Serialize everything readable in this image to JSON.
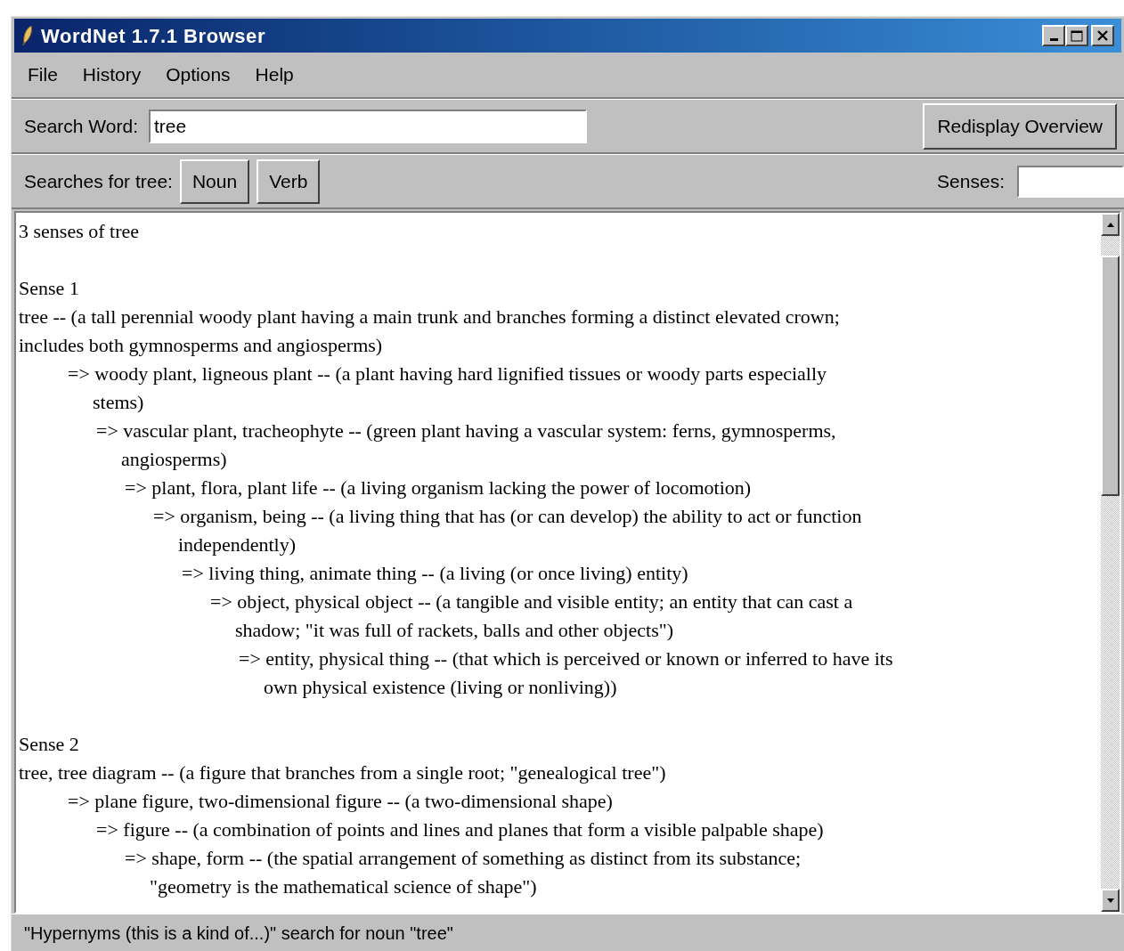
{
  "window": {
    "title": "WordNet 1.7.1 Browser"
  },
  "menu": [
    "File",
    "History",
    "Options",
    "Help"
  ],
  "search": {
    "label": "Search Word:",
    "value": "tree",
    "button": "Redisplay Overview"
  },
  "searches": {
    "label": "Searches for tree:",
    "buttons": [
      "Noun",
      "Verb"
    ],
    "senses_label": "Senses:"
  },
  "content": {
    "heading": "3 senses of tree",
    "senses": [
      {
        "title": "Sense 1",
        "entry": {
          "lines": [
            "tree -- (a tall perennial woody plant having a main trunk and branches forming a distinct elevated crown;",
            "includes both gymnosperms and angiosperms)"
          ],
          "children": [
            {
              "lines": [
                "=> woody plant, ligneous plant -- (a plant having hard lignified tissues or woody parts especially",
                "stems)"
              ],
              "children": [
                {
                  "lines": [
                    "=> vascular plant, tracheophyte -- (green plant having a vascular system: ferns, gymnosperms,",
                    "angiosperms)"
                  ],
                  "children": [
                    {
                      "lines": [
                        "=> plant, flora, plant life -- (a living organism lacking the power of locomotion)"
                      ],
                      "children": [
                        {
                          "lines": [
                            "=> organism, being -- (a living thing that has (or can develop) the ability to act or function",
                            "independently)"
                          ],
                          "children": [
                            {
                              "lines": [
                                "=> living thing, animate thing -- (a living (or once living) entity)"
                              ],
                              "children": [
                                {
                                  "lines": [
                                    "=> object, physical object -- (a tangible and visible entity; an entity that can cast a",
                                    "shadow; \"it was full of rackets, balls and other objects\")"
                                  ],
                                  "children": [
                                    {
                                      "lines": [
                                        "=> entity, physical thing -- (that which is perceived or known or inferred to have its",
                                        "own physical existence (living or nonliving))"
                                      ]
                                    }
                                  ]
                                }
                              ]
                            }
                          ]
                        }
                      ]
                    }
                  ]
                }
              ]
            }
          ]
        }
      },
      {
        "title": "Sense 2",
        "entry": {
          "lines": [
            "tree, tree diagram -- (a figure that branches from a single root; \"genealogical tree\")"
          ],
          "children": [
            {
              "lines": [
                "=> plane figure, two-dimensional figure -- (a two-dimensional shape)"
              ],
              "children": [
                {
                  "lines": [
                    "=> figure -- (a combination of points and lines and planes that form a visible palpable shape)"
                  ],
                  "children": [
                    {
                      "lines": [
                        "=> shape, form -- (the spatial arrangement of something as distinct from its substance;",
                        "\"geometry is the mathematical science of shape\")"
                      ]
                    }
                  ]
                }
              ]
            }
          ]
        }
      }
    ]
  },
  "status_bar": "\"Hypernyms (this is a kind of...)\" search for noun \"tree\""
}
